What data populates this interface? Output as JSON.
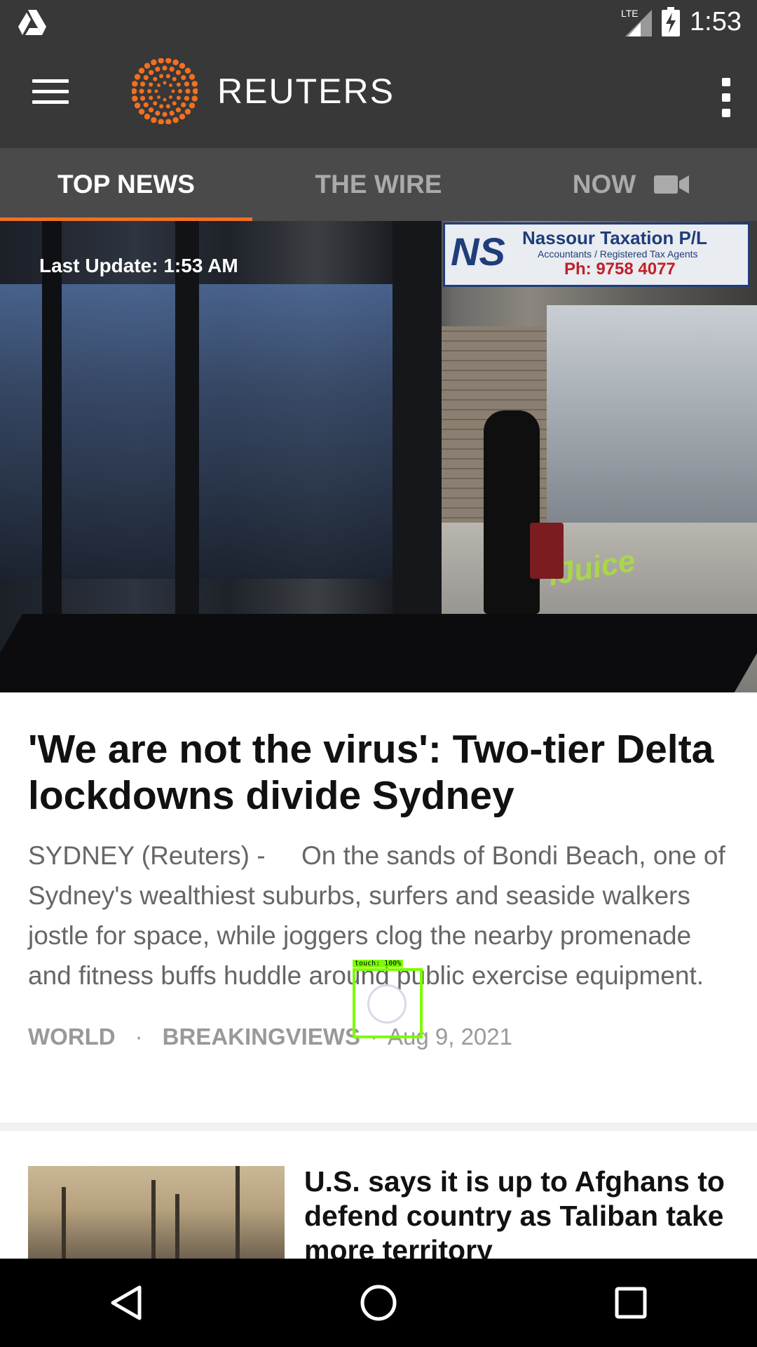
{
  "status": {
    "time": "1:53",
    "network": "LTE"
  },
  "app": {
    "name": "REUTERS"
  },
  "tabs": [
    {
      "label": "TOP NEWS",
      "active": true
    },
    {
      "label": "THE WIRE",
      "active": false
    },
    {
      "label": "NOW",
      "active": false,
      "icon": "video-camera-icon"
    }
  ],
  "hero": {
    "last_update": "Last Update: 1:53 AM",
    "sign_ns": "NS",
    "sign_title": "Nassour Taxation P/L",
    "sign_sub": "Accountants / Registered Tax Agents",
    "sign_phone": "Ph: 9758 4077",
    "shop_sign": "iJuice"
  },
  "lead_article": {
    "headline": "'We are not the virus': Two-tier Delta lockdowns divide Sydney",
    "summary": "SYDNEY (Reuters) -     On the sands of Bondi Beach, one of Sydney's wealthiest suburbs, surfers and seaside walkers jostle for space, while joggers clog the nearby promenade and fitness buffs huddle around public exercise equipment.",
    "category1": "WORLD",
    "category2": "BREAKINGVIEWS",
    "date": "Aug 9, 2021"
  },
  "second_article": {
    "headline": "U.S. says it is up to Afghans to defend country as Taliban take more territory"
  },
  "touch_overlay": {
    "label": "touch: 100%"
  },
  "colors": {
    "accent": "#f36f21",
    "appbar": "#383838",
    "tabbar": "#4a4a4a"
  }
}
